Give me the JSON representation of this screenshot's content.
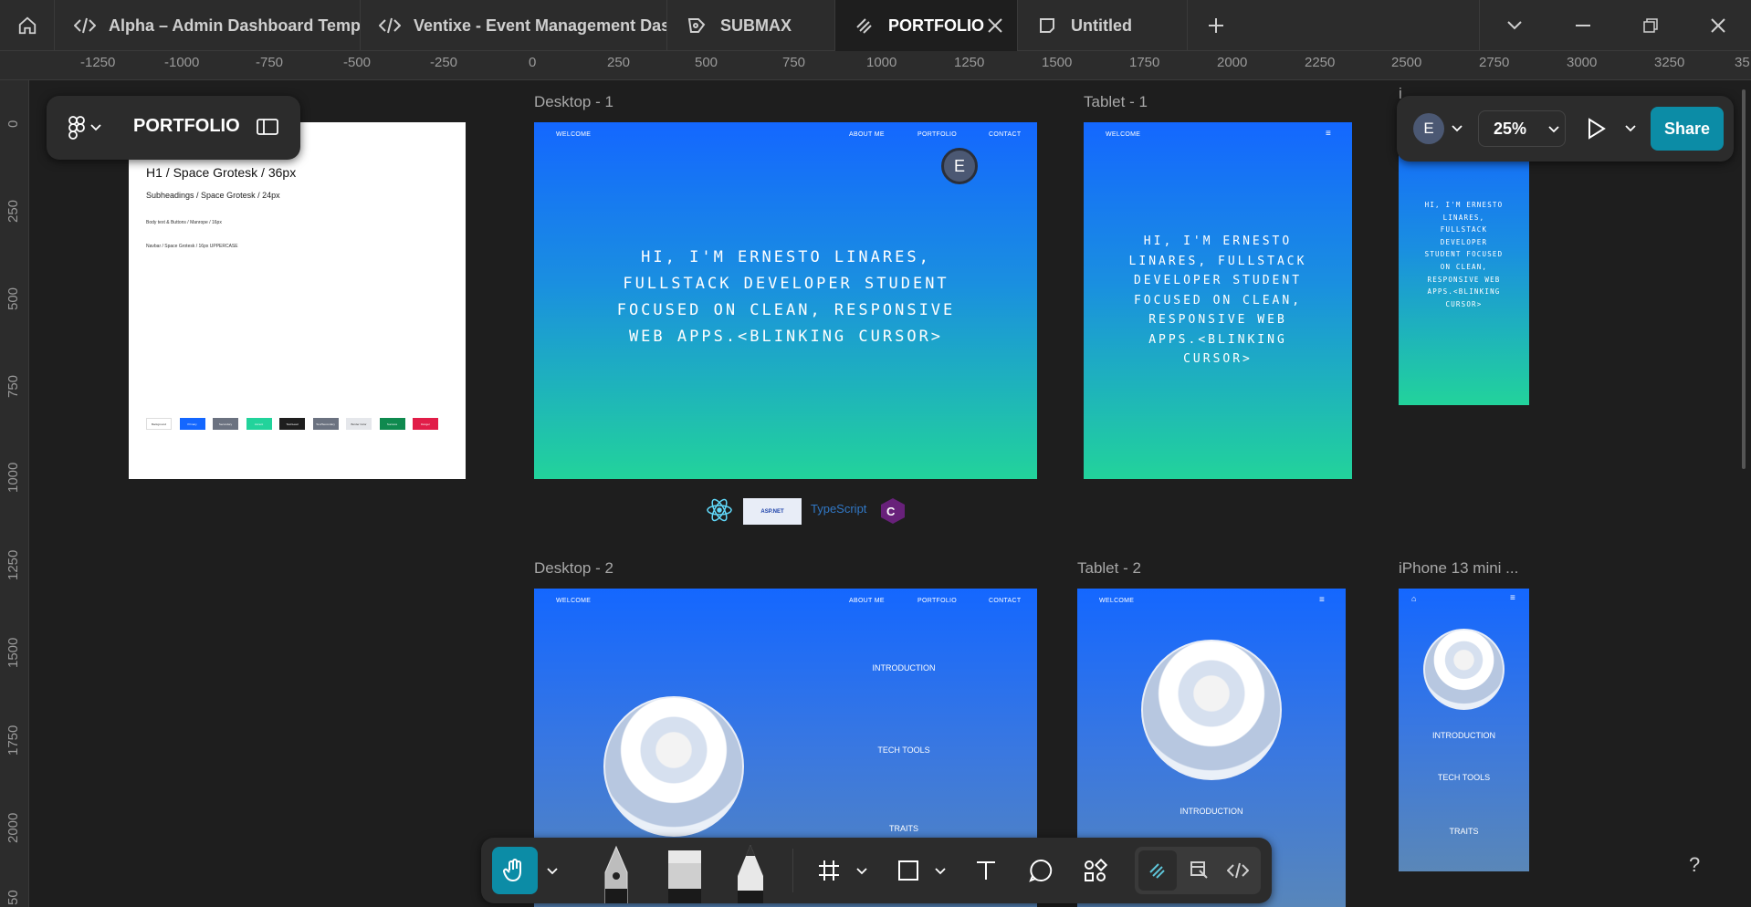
{
  "tabs": [
    {
      "label": "Alpha – Admin Dashboard Templa",
      "icon": "code-icon"
    },
    {
      "label": "Ventixe - Event Management Das",
      "icon": "code-icon"
    },
    {
      "label": "SUBMAX",
      "icon": "design-file-icon"
    },
    {
      "label": "PORTFOLIO",
      "icon": "draw-icon",
      "active": true
    },
    {
      "label": "Untitled",
      "icon": "whiteboard-icon"
    }
  ],
  "ruler": {
    "h": [
      "-1250",
      "-1000",
      "-750",
      "-500",
      "-250",
      "0",
      "250",
      "500",
      "750",
      "1000",
      "1250",
      "1500",
      "1750",
      "2000",
      "2250",
      "2500",
      "2750",
      "3000",
      "3250",
      "35"
    ],
    "v": [
      "0",
      "250",
      "500",
      "750",
      "1000",
      "1250",
      "1500",
      "1750",
      "2000",
      "50"
    ]
  },
  "file_panel": {
    "title": "PORTFOLIO"
  },
  "style_sheet": {
    "h1": "H1 / Space Grotesk / 36px",
    "sub": "Subheadings / Space Grotesk / 24px",
    "body": "Body text & Buttons / Manrope / 16px",
    "navbar": "Navbar / Space Grotesk / 16px UPPERCASE",
    "swatches": [
      {
        "name": "Background",
        "color": "#ffffff",
        "text": "#333333"
      },
      {
        "name": "Primary",
        "color": "#1467ff",
        "text": "#ffffff"
      },
      {
        "name": "Secondary",
        "color": "#6b7280",
        "text": "#ffffff"
      },
      {
        "name": "Accent",
        "color": "#22d39b",
        "text": "#ffffff"
      },
      {
        "name": "Text/Lead",
        "color": "#1e1e1e",
        "text": "#ffffff"
      },
      {
        "name": "Text/Secondary",
        "color": "#6b7280",
        "text": "#ffffff"
      },
      {
        "name": "Border Color",
        "color": "#e5e7eb",
        "text": "#333333"
      },
      {
        "name": "Success",
        "color": "#0f8a4f",
        "text": "#ffffff"
      },
      {
        "name": "Danger",
        "color": "#e11d48",
        "text": "#ffffff"
      }
    ]
  },
  "frames": {
    "desktop1": {
      "label": "Desktop - 1",
      "nav_left": "WELCOME",
      "nav_links": [
        "ABOUT ME",
        "PORTFOLIO",
        "CONTACT"
      ],
      "hero": "HI, I'M ERNESTO LINARES, FULLSTACK DEVELOPER STUDENT FOCUSED ON CLEAN, RESPONSIVE WEB APPS.<BLINKING CURSOR>"
    },
    "tablet1": {
      "label": "Tablet - 1",
      "nav_left": "WELCOME",
      "hero": "HI, I'M ERNESTO LINARES, FULLSTACK DEVELOPER STUDENT FOCUSED ON CLEAN, RESPONSIVE WEB APPS.<BLINKING CURSOR>"
    },
    "phone1": {
      "label": "i",
      "hero": "HI, I'M ERNESTO LINARES, FULLSTACK DEVELOPER STUDENT FOCUSED ON CLEAN, RESPONSIVE WEB APPS.<BLINKING CURSOR>"
    },
    "desktop2": {
      "label": "Desktop - 2",
      "nav_left": "WELCOME",
      "nav_links": [
        "ABOUT ME",
        "PORTFOLIO",
        "CONTACT"
      ],
      "items": [
        "INTRODUCTION",
        "TECH TOOLS",
        "TRAITS"
      ]
    },
    "tablet2": {
      "label": "Tablet - 2",
      "nav_left": "WELCOME",
      "items": [
        "INTRODUCTION"
      ]
    },
    "phone2": {
      "label": "iPhone 13 mini ...",
      "items": [
        "INTRODUCTION",
        "TECH TOOLS",
        "TRAITS"
      ]
    }
  },
  "logos": {
    "typescript": "TypeScript",
    "aspnet": "ASP.NET"
  },
  "collaborator": {
    "initial": "E"
  },
  "right_panel": {
    "avatar": "E",
    "zoom": "25%",
    "share": "Share"
  },
  "help": "?"
}
